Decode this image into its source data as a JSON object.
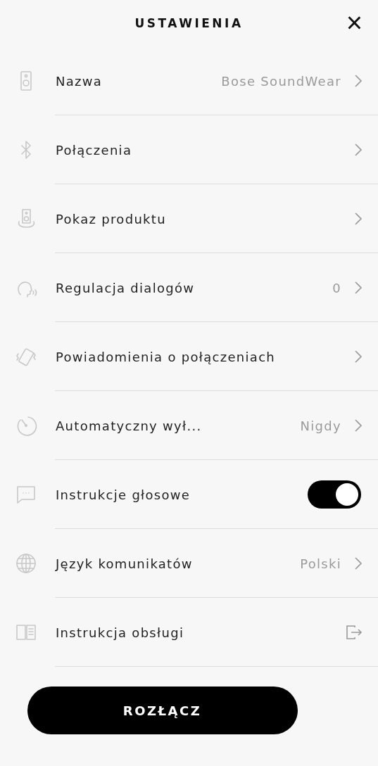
{
  "header": {
    "title": "USTAWIENIA",
    "close": "×"
  },
  "rows": [
    {
      "kind": "link",
      "label": "Nazwa",
      "value": "Bose SoundWear"
    },
    {
      "kind": "link",
      "label": "Połączenia"
    },
    {
      "kind": "link",
      "label": "Pokaz produktu"
    },
    {
      "kind": "link",
      "label": "Regulacja dialogów",
      "value": "0"
    },
    {
      "kind": "link",
      "label": "Powiadomienia o połączeniach"
    },
    {
      "kind": "link",
      "label": "Automatyczny wył...",
      "value": "Nigdy"
    },
    {
      "kind": "toggle",
      "label": "Instrukcje głosowe",
      "on": true
    },
    {
      "kind": "link",
      "label": "Język komunikatów",
      "value": "Polski"
    },
    {
      "kind": "external",
      "label": "Instrukcja obsługi"
    }
  ],
  "disconnect_button": "ROZŁĄCZ"
}
